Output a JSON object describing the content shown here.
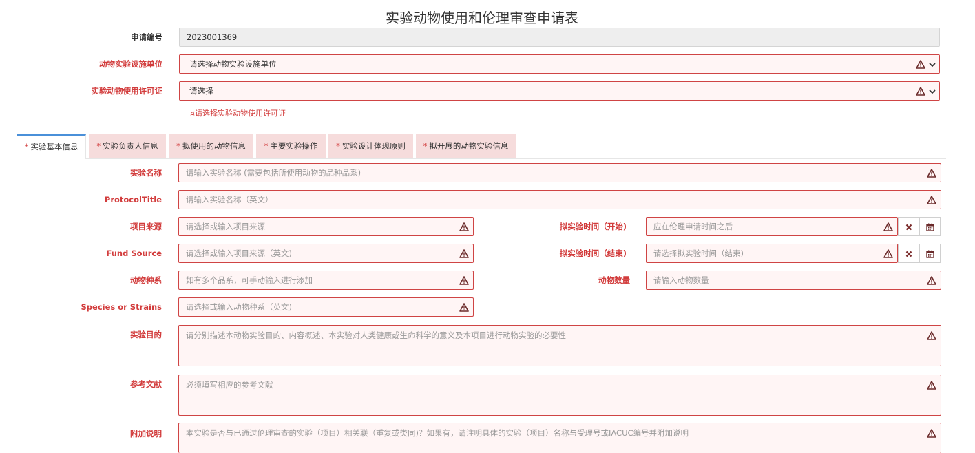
{
  "title": "实验动物使用和伦理审查申请表",
  "header": {
    "app_no_label": "申请编号",
    "app_no_value": "2023001369",
    "facility_label": "动物实验设施单位",
    "facility_value": "请选择动物实验设施单位",
    "license_label": "实验动物使用许可证",
    "license_value": "请选择",
    "license_hint": "¤请选择实验动物使用许可证"
  },
  "tabs": [
    {
      "star": "*",
      "label": "实验基本信息",
      "active": true
    },
    {
      "star": "*",
      "label": "实验负责人信息",
      "active": false
    },
    {
      "star": "*",
      "label": "拟使用的动物信息",
      "active": false
    },
    {
      "star": "*",
      "label": "主要实验操作",
      "active": false
    },
    {
      "star": "*",
      "label": "实验设计体现原则",
      "active": false
    },
    {
      "star": "*",
      "label": "拟开展的动物实验信息",
      "active": false
    }
  ],
  "form": {
    "exp_name": {
      "label": "实验名称",
      "placeholder": "请输入实验名称 (需要包括所使用动物的品种品系)"
    },
    "protocol_title": {
      "label": "ProtocolTitle",
      "placeholder": "请输入实验名称（英文）"
    },
    "project_source": {
      "label": "项目来源",
      "placeholder": "请选择或输入项目来源"
    },
    "fund_source": {
      "label": "Fund Source",
      "placeholder": "请选择或输入项目来源（英文)"
    },
    "species": {
      "label": "动物种系",
      "placeholder": "如有多个品系，可手动输入进行添加"
    },
    "species_en": {
      "label": "Species or Strains",
      "placeholder": "请选择或输入动物种系（英文)"
    },
    "start_time": {
      "label": "拟实验时间（开始)",
      "placeholder": "应在伦理申请时间之后"
    },
    "end_time": {
      "label": "拟实验时间（结束)",
      "placeholder": "请选择拟实验时间（结束)"
    },
    "animal_count": {
      "label": "动物数量",
      "placeholder": "请输入动物数量"
    },
    "purpose": {
      "label": "实验目的",
      "placeholder": "请分别描述本动物实验目的、内容概述、本实验对人类健康或生命科学的意义及本项目进行动物实验的必要性"
    },
    "references": {
      "label": "参考文献",
      "placeholder": "必须填写相应的参考文献"
    },
    "notes": {
      "label": "附加说明",
      "placeholder": "本实验是否与已通过伦理审查的实验（项目）相关联（重复或类同)？如果有，请注明具体的实验（项目）名称与受理号或IACUC编号并附加说明"
    }
  },
  "icons": {
    "warning": "warning-triangle-icon",
    "chevron": "chevron-down-icon",
    "clear": "clear-x-icon",
    "calendar": "calendar-icon"
  },
  "colors": {
    "error": "#d23c3c",
    "error_bg": "#fff5f5",
    "tab_bg": "#f6dcdc",
    "tab_active_border": "#4a90d9"
  }
}
